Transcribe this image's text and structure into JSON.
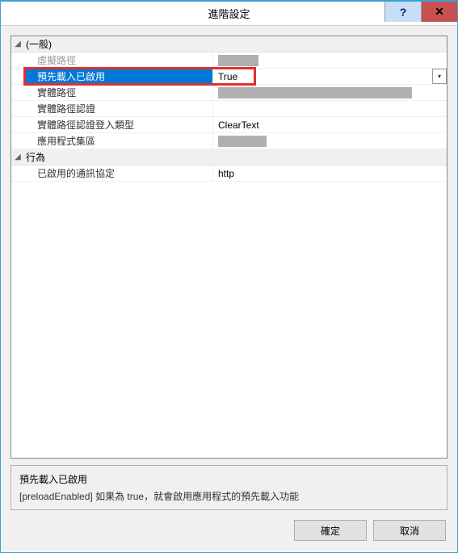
{
  "window": {
    "title": "進階設定"
  },
  "categories": {
    "general": {
      "label": "(一般)",
      "items": {
        "virtual_path": {
          "label": "虛擬路徑",
          "value": ""
        },
        "preload_enabled": {
          "label": "預先載入已啟用",
          "value": "True"
        },
        "physical_path": {
          "label": "實體路徑",
          "value": ""
        },
        "physical_path_creds": {
          "label": "實體路徑認證",
          "value": ""
        },
        "physical_path_creds_logon": {
          "label": "實體路徑認證登入類型",
          "value": "ClearText"
        },
        "app_pool": {
          "label": "應用程式集區",
          "value": ""
        }
      }
    },
    "behavior": {
      "label": "行為",
      "items": {
        "enabled_protocols": {
          "label": "已啟用的通訊協定",
          "value": "http"
        }
      }
    }
  },
  "description": {
    "title": "預先載入已啟用",
    "text": "[preloadEnabled] 如果為 true，就會啟用應用程式的預先載入功能"
  },
  "buttons": {
    "ok": "確定",
    "cancel": "取消"
  }
}
